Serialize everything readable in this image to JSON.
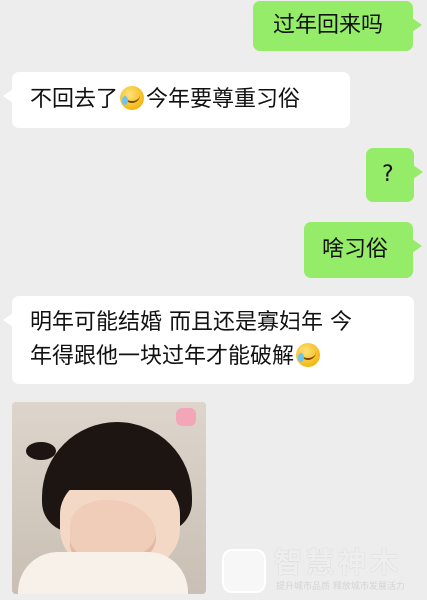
{
  "colors": {
    "background": "#ededed",
    "sent_bubble": "#95ec69",
    "received_bubble": "#ffffff",
    "text": "#111111"
  },
  "messages": [
    {
      "side": "sent",
      "text": "过年回来吗"
    },
    {
      "side": "received",
      "text_before": "不回去了",
      "emoji": "tears-of-joy-emoji",
      "text_after": "今年要尊重习俗"
    },
    {
      "side": "sent",
      "text": "?"
    },
    {
      "side": "sent",
      "text": "啥习俗"
    },
    {
      "side": "received",
      "line1": "明年可能结婚 而且还是寡妇年 今",
      "line2": "年得跟他一块过年才能破解",
      "emoji": "tears-of-joy-emoji"
    },
    {
      "side": "received",
      "type": "image",
      "content": "child-covering-face-photo"
    }
  ],
  "watermark": {
    "logo_text": "智慧神木",
    "name": "智慧神木",
    "tagline": "提升城市品质 释放城市发展活力"
  }
}
